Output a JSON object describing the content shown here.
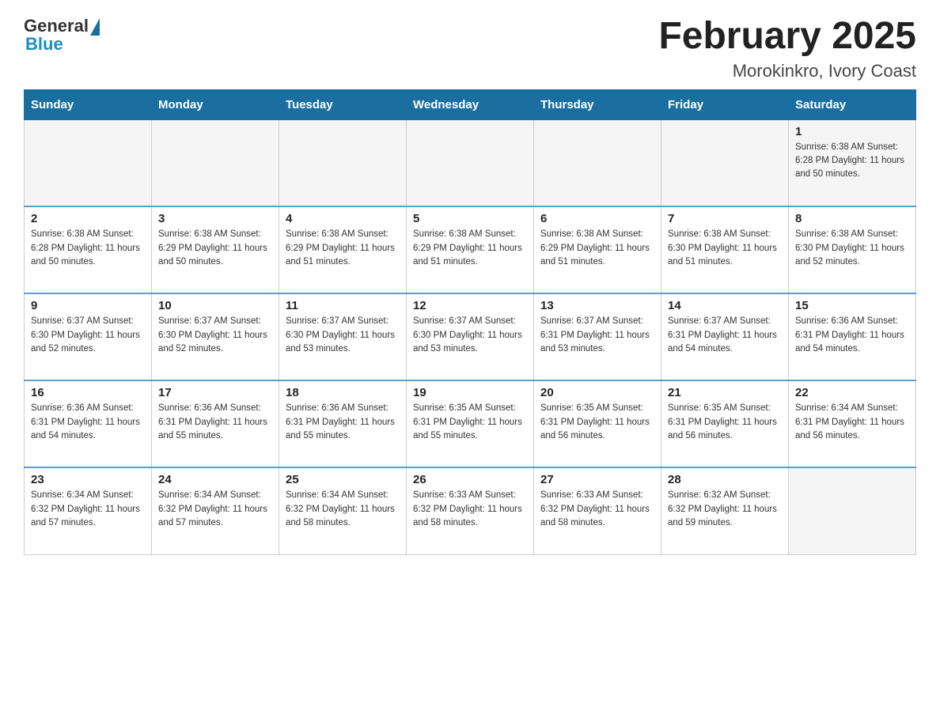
{
  "logo": {
    "general": "General",
    "blue": "Blue"
  },
  "title": "February 2025",
  "subtitle": "Morokinkro, Ivory Coast",
  "weekdays": [
    "Sunday",
    "Monday",
    "Tuesday",
    "Wednesday",
    "Thursday",
    "Friday",
    "Saturday"
  ],
  "weeks": [
    [
      {
        "day": "",
        "info": ""
      },
      {
        "day": "",
        "info": ""
      },
      {
        "day": "",
        "info": ""
      },
      {
        "day": "",
        "info": ""
      },
      {
        "day": "",
        "info": ""
      },
      {
        "day": "",
        "info": ""
      },
      {
        "day": "1",
        "info": "Sunrise: 6:38 AM\nSunset: 6:28 PM\nDaylight: 11 hours\nand 50 minutes."
      }
    ],
    [
      {
        "day": "2",
        "info": "Sunrise: 6:38 AM\nSunset: 6:28 PM\nDaylight: 11 hours\nand 50 minutes."
      },
      {
        "day": "3",
        "info": "Sunrise: 6:38 AM\nSunset: 6:29 PM\nDaylight: 11 hours\nand 50 minutes."
      },
      {
        "day": "4",
        "info": "Sunrise: 6:38 AM\nSunset: 6:29 PM\nDaylight: 11 hours\nand 51 minutes."
      },
      {
        "day": "5",
        "info": "Sunrise: 6:38 AM\nSunset: 6:29 PM\nDaylight: 11 hours\nand 51 minutes."
      },
      {
        "day": "6",
        "info": "Sunrise: 6:38 AM\nSunset: 6:29 PM\nDaylight: 11 hours\nand 51 minutes."
      },
      {
        "day": "7",
        "info": "Sunrise: 6:38 AM\nSunset: 6:30 PM\nDaylight: 11 hours\nand 51 minutes."
      },
      {
        "day": "8",
        "info": "Sunrise: 6:38 AM\nSunset: 6:30 PM\nDaylight: 11 hours\nand 52 minutes."
      }
    ],
    [
      {
        "day": "9",
        "info": "Sunrise: 6:37 AM\nSunset: 6:30 PM\nDaylight: 11 hours\nand 52 minutes."
      },
      {
        "day": "10",
        "info": "Sunrise: 6:37 AM\nSunset: 6:30 PM\nDaylight: 11 hours\nand 52 minutes."
      },
      {
        "day": "11",
        "info": "Sunrise: 6:37 AM\nSunset: 6:30 PM\nDaylight: 11 hours\nand 53 minutes."
      },
      {
        "day": "12",
        "info": "Sunrise: 6:37 AM\nSunset: 6:30 PM\nDaylight: 11 hours\nand 53 minutes."
      },
      {
        "day": "13",
        "info": "Sunrise: 6:37 AM\nSunset: 6:31 PM\nDaylight: 11 hours\nand 53 minutes."
      },
      {
        "day": "14",
        "info": "Sunrise: 6:37 AM\nSunset: 6:31 PM\nDaylight: 11 hours\nand 54 minutes."
      },
      {
        "day": "15",
        "info": "Sunrise: 6:36 AM\nSunset: 6:31 PM\nDaylight: 11 hours\nand 54 minutes."
      }
    ],
    [
      {
        "day": "16",
        "info": "Sunrise: 6:36 AM\nSunset: 6:31 PM\nDaylight: 11 hours\nand 54 minutes."
      },
      {
        "day": "17",
        "info": "Sunrise: 6:36 AM\nSunset: 6:31 PM\nDaylight: 11 hours\nand 55 minutes."
      },
      {
        "day": "18",
        "info": "Sunrise: 6:36 AM\nSunset: 6:31 PM\nDaylight: 11 hours\nand 55 minutes."
      },
      {
        "day": "19",
        "info": "Sunrise: 6:35 AM\nSunset: 6:31 PM\nDaylight: 11 hours\nand 55 minutes."
      },
      {
        "day": "20",
        "info": "Sunrise: 6:35 AM\nSunset: 6:31 PM\nDaylight: 11 hours\nand 56 minutes."
      },
      {
        "day": "21",
        "info": "Sunrise: 6:35 AM\nSunset: 6:31 PM\nDaylight: 11 hours\nand 56 minutes."
      },
      {
        "day": "22",
        "info": "Sunrise: 6:34 AM\nSunset: 6:31 PM\nDaylight: 11 hours\nand 56 minutes."
      }
    ],
    [
      {
        "day": "23",
        "info": "Sunrise: 6:34 AM\nSunset: 6:32 PM\nDaylight: 11 hours\nand 57 minutes."
      },
      {
        "day": "24",
        "info": "Sunrise: 6:34 AM\nSunset: 6:32 PM\nDaylight: 11 hours\nand 57 minutes."
      },
      {
        "day": "25",
        "info": "Sunrise: 6:34 AM\nSunset: 6:32 PM\nDaylight: 11 hours\nand 58 minutes."
      },
      {
        "day": "26",
        "info": "Sunrise: 6:33 AM\nSunset: 6:32 PM\nDaylight: 11 hours\nand 58 minutes."
      },
      {
        "day": "27",
        "info": "Sunrise: 6:33 AM\nSunset: 6:32 PM\nDaylight: 11 hours\nand 58 minutes."
      },
      {
        "day": "28",
        "info": "Sunrise: 6:32 AM\nSunset: 6:32 PM\nDaylight: 11 hours\nand 59 minutes."
      },
      {
        "day": "",
        "info": ""
      }
    ]
  ]
}
